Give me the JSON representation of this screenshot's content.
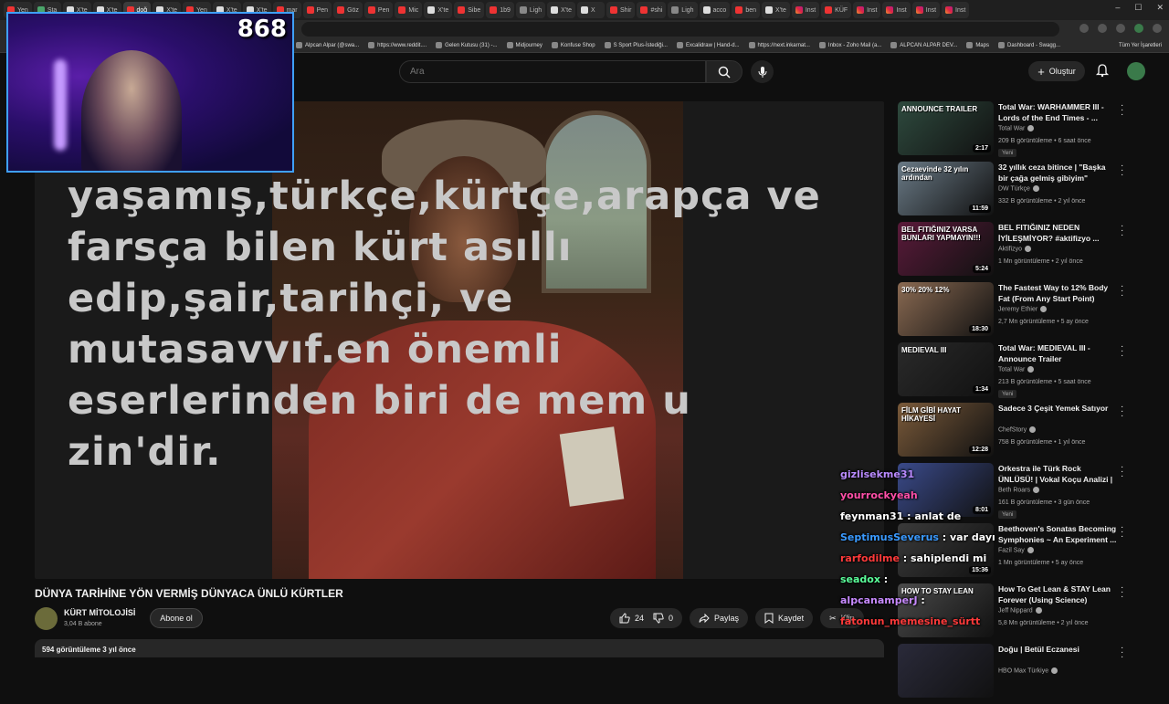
{
  "browser": {
    "tabs": [
      {
        "label": "Yen",
        "fav": "yt"
      },
      {
        "label": "Sta",
        "fav": "g"
      },
      {
        "label": "X'te",
        "fav": "x"
      },
      {
        "label": "X'te",
        "fav": "x"
      },
      {
        "label": "doğ",
        "fav": "yt"
      },
      {
        "label": "X'te",
        "fav": "x"
      },
      {
        "label": "Yen",
        "fav": "yt"
      },
      {
        "label": "X'te",
        "fav": "x"
      },
      {
        "label": "X'te",
        "fav": "x"
      },
      {
        "label": "mar",
        "fav": "yt"
      },
      {
        "label": "Pen",
        "fav": "yt"
      },
      {
        "label": "Göz",
        "fav": "yt"
      },
      {
        "label": "Pen",
        "fav": "yt"
      },
      {
        "label": "Mic",
        "fav": "yt"
      },
      {
        "label": "X'te",
        "fav": "x"
      },
      {
        "label": "Sibe",
        "fav": "yt"
      },
      {
        "label": "1b9",
        "fav": "yt"
      },
      {
        "label": "Ligh",
        "fav": "p"
      },
      {
        "label": "X'te",
        "fav": "x"
      },
      {
        "label": "X",
        "fav": "x"
      },
      {
        "label": "Shir",
        "fav": "yt"
      },
      {
        "label": "#shi",
        "fav": "yt"
      },
      {
        "label": "Ligh",
        "fav": "p"
      },
      {
        "label": "acco",
        "fav": "x"
      },
      {
        "label": "ben",
        "fav": "yt"
      },
      {
        "label": "X'te",
        "fav": "x"
      },
      {
        "label": "Inst",
        "fav": "ig"
      },
      {
        "label": "KÜF",
        "fav": "yt"
      },
      {
        "label": "Inst",
        "fav": "ig"
      },
      {
        "label": "Inst",
        "fav": "ig"
      },
      {
        "label": "Inst",
        "fav": "ig"
      },
      {
        "label": "Inst",
        "fav": "ig"
      }
    ],
    "bookmarks": [
      "Alpcan Alpar (@swa...",
      "https://www.reddit....",
      "Gelen Kutusu (31) -...",
      "Midjourney",
      "Konfuse Shop",
      "S Sport Plus-İstediği...",
      "Excalidraw | Hand-d...",
      "https://next.inkarnat...",
      "Inbox - Zoho Mail (a...",
      "ALPCAN ALPAR DEV...",
      "Maps",
      "Dashboard - Swagg..."
    ],
    "bookmarks_right": "Tüm Yer İşaretleri"
  },
  "header": {
    "search_placeholder": "Ara",
    "create_label": "Oluştur"
  },
  "stream": {
    "viewer_count": "868"
  },
  "video": {
    "overlay_text": "da\nyaşamış,türkçe,kürtçe,arapça ve\nfarsça bilen kürt asıllı\nedip,şair,tarihçi, ve\nmutasavvıf.en önemli\neserlerinden biri de mem u\nzin'dir.",
    "title": "DÜNYA TARİHİNE YÖN VERMİŞ DÜNYACA ÜNLÜ KÜRTLER",
    "channel": "KÜRT MİTOLOJİSİ",
    "subscribers": "3,04 B abone",
    "subscribe_label": "Abone ol",
    "likes": "24",
    "dislikes": "0",
    "share_label": "Paylaş",
    "save_label": "Kaydet",
    "clip_label": "Klip",
    "views_date": "594 görüntüleme  3 yıl önce"
  },
  "sidebar": [
    {
      "title": "Total War: WARHAMMER III - Lords of the End Times - ...",
      "channel": "Total War",
      "meta": "209 B görüntüleme • 6 saat önce",
      "badge": "Yeni",
      "duration": "2:17",
      "thumb_text": "ANNOUNCE TRAILER",
      "color": "#2e4a3e"
    },
    {
      "title": "32 yıllık ceza bitince | \"Başka bir çağa gelmiş gibiyim\"",
      "channel": "DW Türkçe",
      "meta": "332 B görüntüleme • 2 yıl önce",
      "badge": "",
      "duration": "11:59",
      "thumb_text": "Cezaevinde 32 yılın ardından",
      "color": "#6a7a86"
    },
    {
      "title": "BEL FITIĞINIZ NEDEN İYİLEŞMİYOR? #aktifizyo ...",
      "channel": "Aktifizyo",
      "meta": "1 Mn görüntüleme • 2 yıl önce",
      "badge": "",
      "duration": "5:24",
      "thumb_text": "BEL FITIĞINIZ VARSA BUNLARI YAPMAYIN!!!",
      "color": "#5a1a3a"
    },
    {
      "title": "The Fastest Way to 12% Body Fat (From Any Start Point)",
      "channel": "Jeremy Ethier",
      "meta": "2,7 Mn görüntüleme • 5 ay önce",
      "badge": "",
      "duration": "18:30",
      "thumb_text": "30%   20%   12%",
      "color": "#8a6a52"
    },
    {
      "title": "Total War: MEDIEVAL III - Announce Trailer",
      "channel": "Total War",
      "meta": "213 B görüntüleme • 5 saat önce",
      "badge": "Yeni",
      "duration": "1:34",
      "thumb_text": "MEDIEVAL III",
      "color": "#2a2a2a"
    },
    {
      "title": "Sadece 3 Çeşit Yemek Satıyor",
      "channel": "ChefStory",
      "meta": "758 B görüntüleme • 1 yıl önce",
      "badge": "",
      "duration": "12:28",
      "thumb_text": "FİLM GİBİ HAYAT HİKAYESİ",
      "color": "#7a5a3a"
    },
    {
      "title": "Orkestra ile Türk Rock ÜNLÜSÜ! | Vokal Koçu Analizi | Hayko ...",
      "channel": "Beth Roars",
      "meta": "161 B görüntüleme • 3 gün önce",
      "badge": "Yeni",
      "duration": "8:01",
      "thumb_text": "",
      "color": "#3a4a8a"
    },
    {
      "title": "Beethoven's Sonatas Becoming Symphonies ~ An Experiment ...",
      "channel": "Fazil Say",
      "meta": "1 Mn görüntüleme • 5 ay önce",
      "badge": "",
      "duration": "15:36",
      "thumb_text": "",
      "color": "#3a3a3a"
    },
    {
      "title": "How To Get Lean & STAY Lean Forever (Using Science)",
      "channel": "Jeff Nippard",
      "meta": "5,8 Mn görüntüleme • 2 yıl önce",
      "badge": "",
      "duration": "",
      "thumb_text": "HOW TO STAY LEAN",
      "color": "#4a4a4a"
    },
    {
      "title": "Doğu | Betül Eczanesi",
      "channel": "HBO Max Türkiye",
      "meta": "",
      "badge": "",
      "duration": "",
      "thumb_text": "",
      "color": "#2a2a3a"
    }
  ],
  "chat": [
    {
      "user": "gizlisekme31",
      "msg": "",
      "color": "#b98aff"
    },
    {
      "user": "yourrockyeah",
      "msg": "",
      "color": "#ff4fa8"
    },
    {
      "user": "feynman31",
      "msg": " : anlat de",
      "color": "#ffffff"
    },
    {
      "user": "SeptimusSeverus",
      "msg": " : var dayı",
      "color": "#3a9aff"
    },
    {
      "user": "rarfodilme",
      "msg": " : sahiplendi mi",
      "color": "#ff3a3a"
    },
    {
      "user": "seadox",
      "msg": " :",
      "color": "#5aff9a"
    },
    {
      "user": "alpcanamperJ",
      "msg": " :",
      "color": "#c78aff"
    },
    {
      "user": "fatonun_memesine_sürtt",
      "msg": "",
      "color": "#ff3a3a"
    }
  ]
}
